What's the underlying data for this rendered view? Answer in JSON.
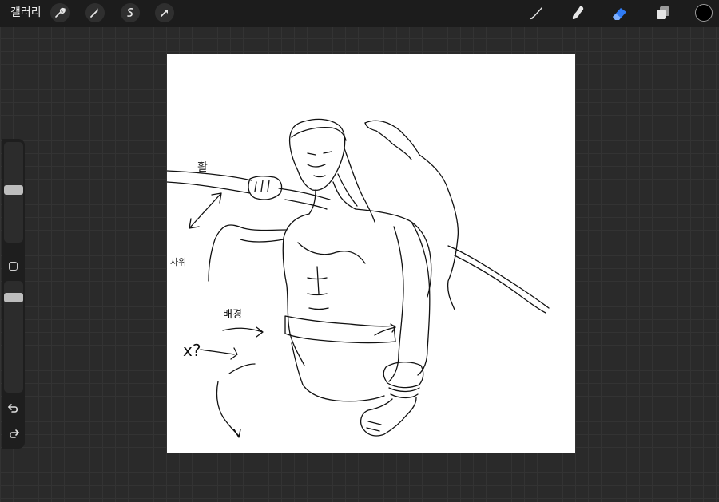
{
  "topbar": {
    "gallery_label": "갤러리",
    "left_tools": [
      "wrench-icon",
      "magic-wand-icon",
      "selection-icon",
      "transform-arrow-icon"
    ],
    "right_tools": [
      "brush-icon",
      "smudge-icon",
      "eraser-icon",
      "layers-icon"
    ],
    "active_tool": "eraser-icon",
    "accent_color": "#2f7bf5",
    "current_color": "#000000"
  },
  "sidebar": {
    "brush_size_level": 0.45,
    "opacity_level": 0.95,
    "controls": [
      "modify-button",
      "undo-icon",
      "redo-icon"
    ]
  },
  "canvas": {
    "annotations": {
      "top_left": "활",
      "left_middle": "사위",
      "lower_left": "x?",
      "center_left": "배경"
    }
  }
}
